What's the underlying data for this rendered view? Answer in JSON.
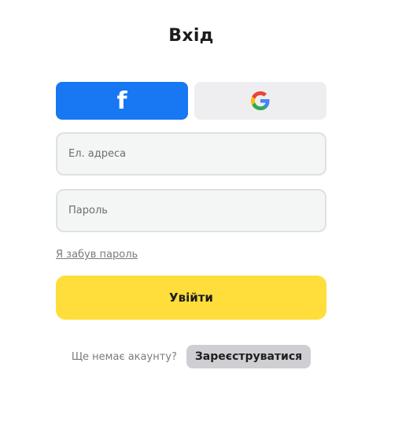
{
  "page": {
    "title": "Вхід"
  },
  "social": {
    "facebook": {
      "icon": "facebook-f-icon",
      "glyph": "f",
      "color": "#1877f2"
    },
    "google": {
      "icon": "google-g-icon",
      "color": "#eeeef0"
    }
  },
  "form": {
    "email_placeholder": "Ел. адреса",
    "password_placeholder": "Пароль",
    "forgot_label": "Я забув пароль",
    "submit_label": "Увійти",
    "submit_color": "#ffdd3a"
  },
  "signup": {
    "prompt": "Ще немає акаунту?",
    "button_label": "Зареєструватися"
  }
}
